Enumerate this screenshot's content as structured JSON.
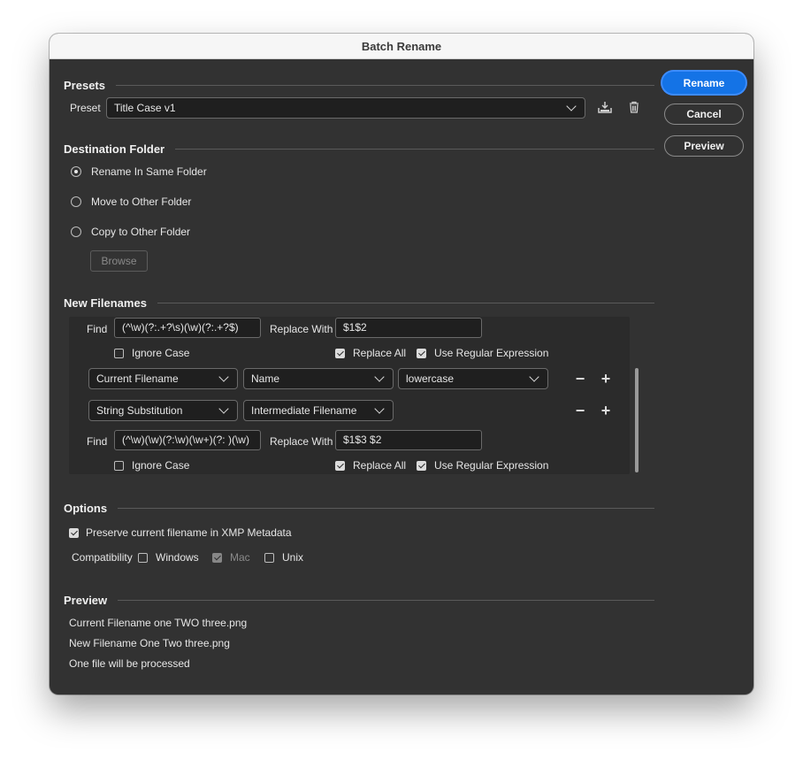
{
  "window": {
    "title": "Batch Rename"
  },
  "buttons": {
    "rename": "Rename",
    "cancel": "Cancel",
    "preview": "Preview"
  },
  "presets": {
    "section_title": "Presets",
    "label": "Preset",
    "selected": "Title Case v1",
    "save_icon": "save-preset-icon",
    "delete_icon": "trash-icon"
  },
  "destination": {
    "section_title": "Destination Folder",
    "options": [
      "Rename In Same Folder",
      "Move to Other Folder",
      "Copy to Other Folder"
    ],
    "selected_index": 0,
    "browse_label": "Browse"
  },
  "new_filenames": {
    "section_title": "New Filenames",
    "rule1": {
      "find_label": "Find",
      "find_value": "(^\\w)(?:.+?\\s)(\\w)(?:.+?$)",
      "replace_label": "Replace With",
      "replace_value": "$1$2",
      "ignore_case": "Ignore Case",
      "ignore_case_checked": false,
      "replace_all": "Replace All",
      "replace_all_checked": true,
      "use_regex": "Use Regular Expression",
      "use_regex_checked": true
    },
    "rule2": {
      "type": "Current Filename",
      "field": "Name",
      "option": "lowercase"
    },
    "rule3": {
      "type": "String Substitution",
      "field": "Intermediate Filename",
      "find_label": "Find",
      "find_value": "(^\\w)(\\w)(?:\\w)(\\w+)(?: )(\\w)",
      "replace_label": "Replace With",
      "replace_value": "$1$3 $2",
      "ignore_case": "Ignore Case",
      "ignore_case_checked": false,
      "replace_all": "Replace All",
      "replace_all_checked": true,
      "use_regex": "Use Regular Expression",
      "use_regex_checked": true
    },
    "minus_symbol": "−",
    "plus_symbol": "+"
  },
  "options": {
    "section_title": "Options",
    "preserve_label": "Preserve current filename in XMP Metadata",
    "preserve_checked": true,
    "compatibility_label": "Compatibility",
    "windows": "Windows",
    "windows_checked": false,
    "mac": "Mac",
    "mac_checked": true,
    "unix": "Unix",
    "unix_checked": false
  },
  "preview": {
    "section_title": "Preview",
    "current": "Current Filename one TWO three.png",
    "new": "New Filename One Two three.png",
    "count": "One file will be processed"
  },
  "colors": {
    "accent": "#1473e6",
    "background": "#323232",
    "field": "#1f1f1f"
  }
}
